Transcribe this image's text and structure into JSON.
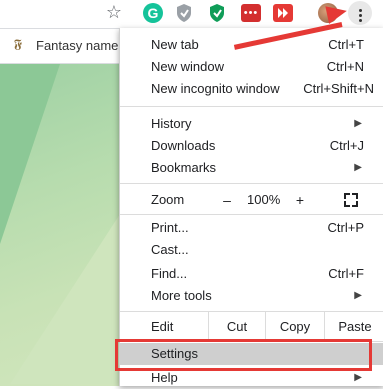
{
  "bookmarks": {
    "item1": "Fantasy name g"
  },
  "menu": {
    "new_tab": "New tab",
    "new_tab_sc": "Ctrl+T",
    "new_window": "New window",
    "new_window_sc": "Ctrl+N",
    "new_incognito": "New incognito window",
    "new_incognito_sc": "Ctrl+Shift+N",
    "history": "History",
    "downloads": "Downloads",
    "downloads_sc": "Ctrl+J",
    "bookmarks": "Bookmarks",
    "zoom": "Zoom",
    "zoom_minus": "–",
    "zoom_value": "100%",
    "zoom_plus": "+",
    "print": "Print...",
    "print_sc": "Ctrl+P",
    "cast": "Cast...",
    "find": "Find...",
    "find_sc": "Ctrl+F",
    "more_tools": "More tools",
    "edit": "Edit",
    "cut": "Cut",
    "copy": "Copy",
    "paste": "Paste",
    "settings": "Settings",
    "help": "Help"
  },
  "colors": {
    "accent_red": "#e53935",
    "settings_highlight": "#cfcfcf"
  }
}
